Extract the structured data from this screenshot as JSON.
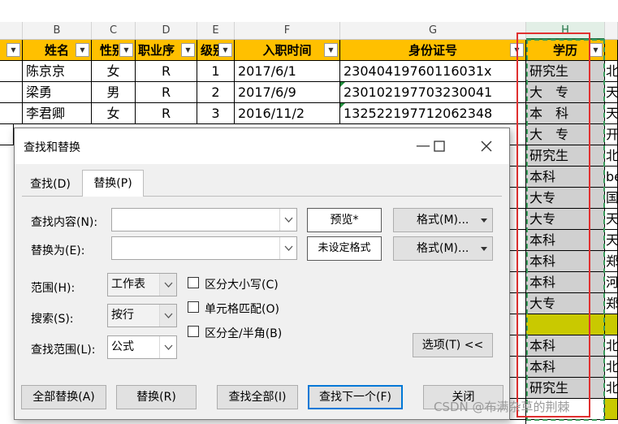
{
  "sheet": {
    "col_letters": [
      "B",
      "C",
      "D",
      "E",
      "F",
      "G",
      "H"
    ],
    "headers": [
      "姓名",
      "性别",
      "职业序",
      "级别",
      "入职时间",
      "身份证号",
      "学历"
    ],
    "rows": [
      {
        "name": "陈京京",
        "sex": "女",
        "seq": "R",
        "lvl": "1",
        "date": "2017/6/1",
        "id": "23040419760116031x",
        "edu": "研究生",
        "extra": "北"
      },
      {
        "name": "梁勇",
        "sex": "男",
        "seq": "R",
        "lvl": "2",
        "date": "2017/6/9",
        "id": "230102197703230041",
        "edu": "大　专",
        "extra": "天"
      },
      {
        "name": "李君卿",
        "sex": "女",
        "seq": "R",
        "lvl": "3",
        "date": "2016/11/2",
        "id": "132522197712062348",
        "edu": "本　科",
        "extra": "天"
      }
    ],
    "edu_column": [
      "研究生",
      "大　专",
      "本　科",
      "大　专",
      "研究生",
      "本科",
      "大专",
      "大专",
      "本科",
      "本科",
      "本科",
      "大专",
      "",
      "本科",
      "本科",
      "研究生"
    ],
    "extra_column": [
      "北",
      "天",
      "天",
      "开",
      "北",
      "be",
      "国",
      "天",
      "天",
      "郑",
      "河",
      "郑",
      "",
      "北",
      "北",
      "北"
    ]
  },
  "dialog": {
    "title": "查找和替换",
    "win_minimize": "—",
    "win_maximize": "☐",
    "win_close": "✕",
    "tabs": {
      "find": "查找(D)",
      "replace": "替换(P)"
    },
    "find_label": "查找内容(N):",
    "replace_label": "替换为(E):",
    "find_value": "",
    "replace_value": "",
    "preview_label": "预览*",
    "unset_format_label": "未设定格式",
    "format_btn_1": "格式(M)...",
    "format_btn_2": "格式(M)...",
    "scope_label": "范围(H):",
    "scope_value": "工作表",
    "search_label": "搜索(S):",
    "search_value": "按行",
    "lookin_label": "查找范围(L):",
    "lookin_value": "公式",
    "match_case": "区分大小写(C)",
    "match_cell": "单元格匹配(O)",
    "match_width": "区分全/半角(B)",
    "options_btn": "选项(T) <<",
    "replace_all": "全部替换(A)",
    "replace": "替换(R)",
    "find_all": "查找全部(I)",
    "find_next": "查找下一个(F)",
    "close": "关闭"
  },
  "watermark": "CSDN @布满杂草的荆棘",
  "colors": {
    "header": "#ffc000",
    "edu_fill": "#d0d0d0",
    "highlight": "#c9c900",
    "accent": "#0078d7",
    "annotation": "#e03030"
  }
}
